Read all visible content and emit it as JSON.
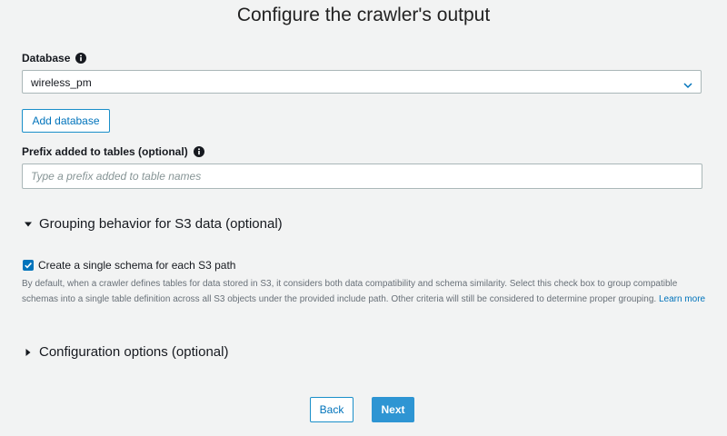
{
  "page": {
    "title": "Configure the crawler's output"
  },
  "database": {
    "label": "Database",
    "selected_value": "wireless_pm",
    "add_button_label": "Add database"
  },
  "prefix": {
    "label": "Prefix added to tables (optional)",
    "value": "",
    "placeholder": "Type a prefix added to table names"
  },
  "grouping": {
    "header": "Grouping behavior for S3 data (optional)",
    "expanded": true,
    "checkbox_label": "Create a single schema for each S3 path",
    "checkbox_checked": true,
    "description": "By default, when a crawler defines tables for data stored in S3, it considers both data compatibility and schema similarity. Select this check box to group compatible schemas into a single table definition across all S3 objects under the provided include path. Other criteria will still be considered to determine proper grouping.",
    "learn_more": "Learn more"
  },
  "configuration": {
    "header": "Configuration options (optional)",
    "expanded": false
  },
  "footer": {
    "back_label": "Back",
    "next_label": "Next"
  },
  "colors": {
    "background": "#f2f3f3",
    "accent_blue": "#0073bb",
    "primary_button": "#2e95d3",
    "border": "#aab7b8",
    "muted_text": "#687078"
  },
  "icons": {
    "info": "info-icon",
    "select_chevron": "chevron-down-icon",
    "expanded_caret": "caret-down-icon",
    "collapsed_caret": "caret-right-icon",
    "checkbox_check": "checkmark-icon"
  }
}
